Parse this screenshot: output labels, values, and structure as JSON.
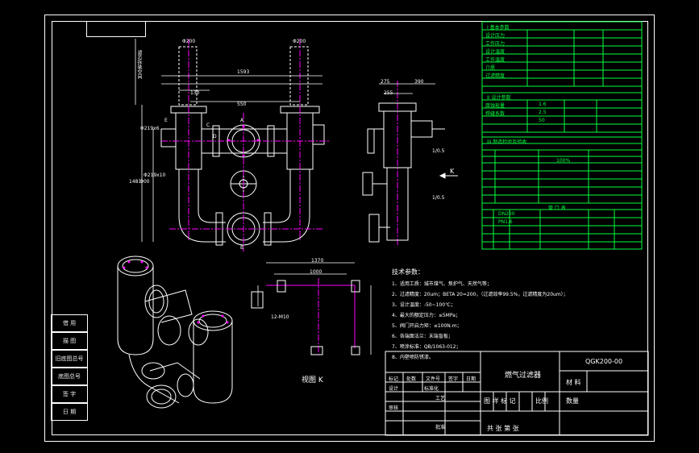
{
  "title_block": {
    "drawing_no": "QGK200-00",
    "name": "燃气过滤器",
    "material_label": "材 料",
    "scale_label": "比例",
    "quantity_label": "数量",
    "sheet_label": "共 张 第 张",
    "header_cols": [
      "标记",
      "处数",
      "文件号",
      "签字",
      "日期"
    ],
    "rows": [
      "设计",
      "审核",
      "工艺",
      "批准"
    ],
    "row_labels_right": [
      "标准化"
    ],
    "stage_label": "图 样 标 记"
  },
  "left_strip": [
    "借 用",
    "描 图",
    "旧底图总号",
    "底图总号",
    "签 字",
    "日 期"
  ],
  "spec_table": {
    "section1": "I 基本参数",
    "section2": "II 设计参数",
    "section3": "III 制造检验及验收",
    "section4": "管 口 表",
    "row_labels": [
      "设计压力",
      "工作压力",
      "设计温度",
      "工作温度",
      "介质",
      "过滤精度",
      "腐蚀裕量",
      "焊缝系数"
    ],
    "values": [
      "1.6",
      "2.5",
      "50",
      "DN200",
      "PN1.6",
      "100%"
    ]
  },
  "notes": {
    "title": "技术参数：",
    "items": [
      "1、适用工质：城市煤气、焦炉气、天然气等；",
      "2、过滤精度：20um；BETA 20=200，（过滤效率99.5%，过滤精度为20um）；",
      "3、设计温度：-50~100℃；",
      "4、最大的额定压力：≤5MPa；",
      "5、阀门开启力矩：≤100N.m；",
      "6、各端面法兰：末端盲板；",
      "7、喷涂标准：QB/1063-012；",
      "8、内壁喷防锈漆。"
    ]
  },
  "view_label": "视图 K",
  "dims": {
    "d1": "Φ200",
    "d2": "Φ200",
    "d3": "1593",
    "d4": "550",
    "d5": "130",
    "d6": "275",
    "d7": "390",
    "d8": "255",
    "d9": "1370",
    "d10": "1000",
    "d11": "1481",
    "d12": "900",
    "d13": "12-M10",
    "d14": "K",
    "d15": "A",
    "d16": "B",
    "d17": "C",
    "d18": "D",
    "d19": "E",
    "side_text": "滤芯拆装空间",
    "r1": "1/0.5",
    "r2": "1/0.5",
    "r3": "Φ219x6",
    "r4": "Φ219x10"
  },
  "colors": {
    "frame": "#ffffff",
    "table": "#00ff40",
    "pipe_axis": "#ff00ff",
    "dim": "#ffffff",
    "hatch": "#ffff00"
  }
}
